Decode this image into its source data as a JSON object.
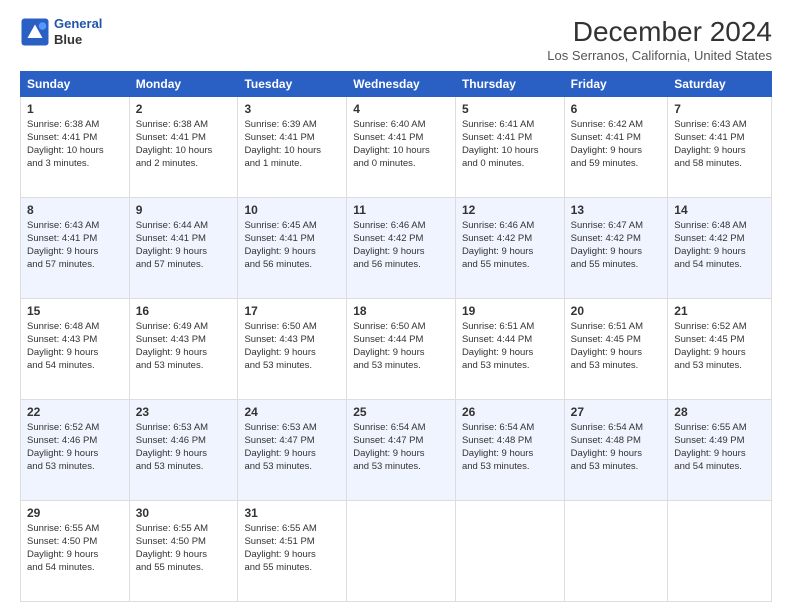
{
  "header": {
    "logo_line1": "General",
    "logo_line2": "Blue",
    "title": "December 2024",
    "subtitle": "Los Serranos, California, United States"
  },
  "columns": [
    "Sunday",
    "Monday",
    "Tuesday",
    "Wednesday",
    "Thursday",
    "Friday",
    "Saturday"
  ],
  "weeks": [
    [
      {
        "day": "1",
        "info": "Sunrise: 6:38 AM\nSunset: 4:41 PM\nDaylight: 10 hours\nand 3 minutes."
      },
      {
        "day": "2",
        "info": "Sunrise: 6:38 AM\nSunset: 4:41 PM\nDaylight: 10 hours\nand 2 minutes."
      },
      {
        "day": "3",
        "info": "Sunrise: 6:39 AM\nSunset: 4:41 PM\nDaylight: 10 hours\nand 1 minute."
      },
      {
        "day": "4",
        "info": "Sunrise: 6:40 AM\nSunset: 4:41 PM\nDaylight: 10 hours\nand 0 minutes."
      },
      {
        "day": "5",
        "info": "Sunrise: 6:41 AM\nSunset: 4:41 PM\nDaylight: 10 hours\nand 0 minutes."
      },
      {
        "day": "6",
        "info": "Sunrise: 6:42 AM\nSunset: 4:41 PM\nDaylight: 9 hours\nand 59 minutes."
      },
      {
        "day": "7",
        "info": "Sunrise: 6:43 AM\nSunset: 4:41 PM\nDaylight: 9 hours\nand 58 minutes."
      }
    ],
    [
      {
        "day": "8",
        "info": "Sunrise: 6:43 AM\nSunset: 4:41 PM\nDaylight: 9 hours\nand 57 minutes."
      },
      {
        "day": "9",
        "info": "Sunrise: 6:44 AM\nSunset: 4:41 PM\nDaylight: 9 hours\nand 57 minutes."
      },
      {
        "day": "10",
        "info": "Sunrise: 6:45 AM\nSunset: 4:41 PM\nDaylight: 9 hours\nand 56 minutes."
      },
      {
        "day": "11",
        "info": "Sunrise: 6:46 AM\nSunset: 4:42 PM\nDaylight: 9 hours\nand 56 minutes."
      },
      {
        "day": "12",
        "info": "Sunrise: 6:46 AM\nSunset: 4:42 PM\nDaylight: 9 hours\nand 55 minutes."
      },
      {
        "day": "13",
        "info": "Sunrise: 6:47 AM\nSunset: 4:42 PM\nDaylight: 9 hours\nand 55 minutes."
      },
      {
        "day": "14",
        "info": "Sunrise: 6:48 AM\nSunset: 4:42 PM\nDaylight: 9 hours\nand 54 minutes."
      }
    ],
    [
      {
        "day": "15",
        "info": "Sunrise: 6:48 AM\nSunset: 4:43 PM\nDaylight: 9 hours\nand 54 minutes."
      },
      {
        "day": "16",
        "info": "Sunrise: 6:49 AM\nSunset: 4:43 PM\nDaylight: 9 hours\nand 53 minutes."
      },
      {
        "day": "17",
        "info": "Sunrise: 6:50 AM\nSunset: 4:43 PM\nDaylight: 9 hours\nand 53 minutes."
      },
      {
        "day": "18",
        "info": "Sunrise: 6:50 AM\nSunset: 4:44 PM\nDaylight: 9 hours\nand 53 minutes."
      },
      {
        "day": "19",
        "info": "Sunrise: 6:51 AM\nSunset: 4:44 PM\nDaylight: 9 hours\nand 53 minutes."
      },
      {
        "day": "20",
        "info": "Sunrise: 6:51 AM\nSunset: 4:45 PM\nDaylight: 9 hours\nand 53 minutes."
      },
      {
        "day": "21",
        "info": "Sunrise: 6:52 AM\nSunset: 4:45 PM\nDaylight: 9 hours\nand 53 minutes."
      }
    ],
    [
      {
        "day": "22",
        "info": "Sunrise: 6:52 AM\nSunset: 4:46 PM\nDaylight: 9 hours\nand 53 minutes."
      },
      {
        "day": "23",
        "info": "Sunrise: 6:53 AM\nSunset: 4:46 PM\nDaylight: 9 hours\nand 53 minutes."
      },
      {
        "day": "24",
        "info": "Sunrise: 6:53 AM\nSunset: 4:47 PM\nDaylight: 9 hours\nand 53 minutes."
      },
      {
        "day": "25",
        "info": "Sunrise: 6:54 AM\nSunset: 4:47 PM\nDaylight: 9 hours\nand 53 minutes."
      },
      {
        "day": "26",
        "info": "Sunrise: 6:54 AM\nSunset: 4:48 PM\nDaylight: 9 hours\nand 53 minutes."
      },
      {
        "day": "27",
        "info": "Sunrise: 6:54 AM\nSunset: 4:48 PM\nDaylight: 9 hours\nand 53 minutes."
      },
      {
        "day": "28",
        "info": "Sunrise: 6:55 AM\nSunset: 4:49 PM\nDaylight: 9 hours\nand 54 minutes."
      }
    ],
    [
      {
        "day": "29",
        "info": "Sunrise: 6:55 AM\nSunset: 4:50 PM\nDaylight: 9 hours\nand 54 minutes."
      },
      {
        "day": "30",
        "info": "Sunrise: 6:55 AM\nSunset: 4:50 PM\nDaylight: 9 hours\nand 55 minutes."
      },
      {
        "day": "31",
        "info": "Sunrise: 6:55 AM\nSunset: 4:51 PM\nDaylight: 9 hours\nand 55 minutes."
      },
      {
        "day": "",
        "info": ""
      },
      {
        "day": "",
        "info": ""
      },
      {
        "day": "",
        "info": ""
      },
      {
        "day": "",
        "info": ""
      }
    ]
  ]
}
